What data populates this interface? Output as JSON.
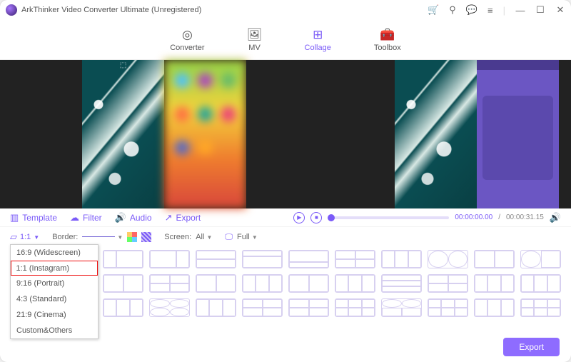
{
  "title": "ArkThinker Video Converter Ultimate (Unregistered)",
  "nav": {
    "converter": "Converter",
    "mv": "MV",
    "collage": "Collage",
    "toolbox": "Toolbox"
  },
  "sub": {
    "template": "Template",
    "filter": "Filter",
    "audio": "Audio",
    "export": "Export"
  },
  "playback": {
    "current": "00:00:00.00",
    "total": "00:00:31.15",
    "sep": "/"
  },
  "opts": {
    "ratio_current": "1:1",
    "border_label": "Border:",
    "screen_label": "Screen:",
    "screen_value": "All",
    "fill_value": "Full"
  },
  "ratio_options": {
    "r169": "16:9 (Widescreen)",
    "r11": "1:1 (Instagram)",
    "r916": "9:16 (Portrait)",
    "r43": "4:3 (Standard)",
    "r219": "21:9 (Cinema)",
    "custom": "Custom&Others"
  },
  "footer": {
    "export": "Export"
  }
}
